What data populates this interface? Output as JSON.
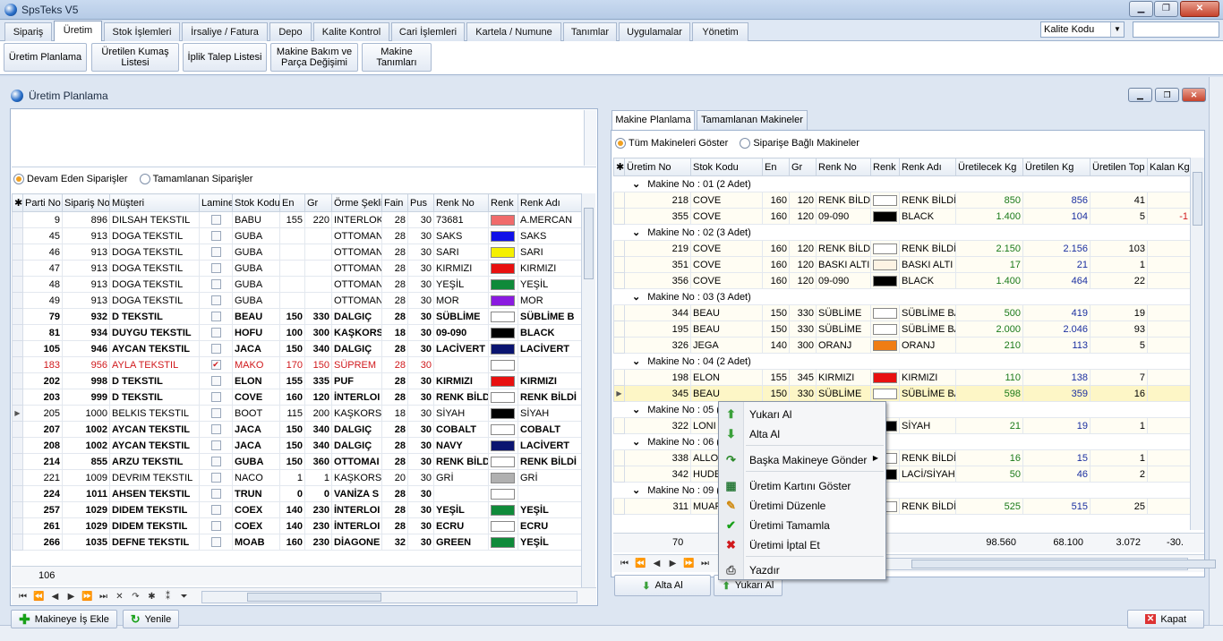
{
  "window": {
    "title": "SpsTeks V5",
    "min": "▁",
    "max": "❐",
    "close": "✕"
  },
  "menu_tabs": [
    "Sipariş",
    "Üretim",
    "Stok İşlemleri",
    "İrsaliye / Fatura",
    "Depo",
    "Kalite Kontrol",
    "Cari İşlemleri",
    "Kartela / Numune",
    "Tanımlar",
    "Uygulamalar",
    "Yönetim"
  ],
  "combo": {
    "value": "Kalite Kodu",
    "arrow": "▼"
  },
  "ribbon": [
    "Üretim Planlama",
    "Üretilen Kumaş Listesi",
    "İplik Talep Listesi",
    "Makine Bakım ve Parça Değişimi",
    "Makine Tanımları"
  ],
  "inner": {
    "title": "Üretim Planlama"
  },
  "left": {
    "radio1": "Devam Eden Siparişler",
    "radio2": "Tamamlanan Siparişler",
    "columns": [
      "Parti No",
      "Sipariş No",
      "Müşteri",
      "Lamine",
      "Stok Kodu",
      "En",
      "Gr",
      "Örme Şekli",
      "Fain",
      "Pus",
      "Renk No",
      "Renk",
      "Renk Adı"
    ],
    "rows": [
      {
        "parti": "9",
        "sip": "896",
        "mus": "DILSAH TEKSTIL",
        "lam": false,
        "stok": "BABU",
        "en": "155",
        "gr": "220",
        "orme": "INTERLOK",
        "fain": "28",
        "pus": "30",
        "rno": "73681",
        "color": "#f06b6b",
        "radi": "A.MERCAN",
        "style": ""
      },
      {
        "parti": "45",
        "sip": "913",
        "mus": "DOGA TEKSTIL",
        "lam": false,
        "stok": "GUBA",
        "en": "",
        "gr": "",
        "orme": "OTTOMAN",
        "fain": "28",
        "pus": "30",
        "rno": "SAKS",
        "color": "#1010e8",
        "radi": "SAKS",
        "style": ""
      },
      {
        "parti": "46",
        "sip": "913",
        "mus": "DOGA TEKSTIL",
        "lam": false,
        "stok": "GUBA",
        "en": "",
        "gr": "",
        "orme": "OTTOMAN",
        "fain": "28",
        "pus": "30",
        "rno": "SARI",
        "color": "#f5f000",
        "radi": "SARI",
        "style": ""
      },
      {
        "parti": "47",
        "sip": "913",
        "mus": "DOGA TEKSTIL",
        "lam": false,
        "stok": "GUBA",
        "en": "",
        "gr": "",
        "orme": "OTTOMAN",
        "fain": "28",
        "pus": "30",
        "rno": "KIRMIZI",
        "color": "#e81010",
        "radi": "KIRMIZI",
        "style": ""
      },
      {
        "parti": "48",
        "sip": "913",
        "mus": "DOGA TEKSTIL",
        "lam": false,
        "stok": "GUBA",
        "en": "",
        "gr": "",
        "orme": "OTTOMAN",
        "fain": "28",
        "pus": "30",
        "rno": "YEŞİL",
        "color": "#0f8a3a",
        "radi": "YEŞİL",
        "style": ""
      },
      {
        "parti": "49",
        "sip": "913",
        "mus": "DOGA TEKSTIL",
        "lam": false,
        "stok": "GUBA",
        "en": "",
        "gr": "",
        "orme": "OTTOMAN",
        "fain": "28",
        "pus": "30",
        "rno": "MOR",
        "color": "#8a1ae0",
        "radi": "MOR",
        "style": ""
      },
      {
        "parti": "79",
        "sip": "932",
        "mus": "D TEKSTIL",
        "lam": false,
        "stok": "BEAU",
        "en": "150",
        "gr": "330",
        "orme": "DALGIÇ",
        "fain": "28",
        "pus": "30",
        "rno": "SÜBLİME",
        "color": "#ffffff",
        "radi": "SÜBLİME B",
        "style": "bold"
      },
      {
        "parti": "81",
        "sip": "934",
        "mus": "DUYGU TEKSTIL",
        "lam": false,
        "stok": "HOFU",
        "en": "100",
        "gr": "300",
        "orme": "KAŞKORS",
        "fain": "18",
        "pus": "30",
        "rno": "09-090",
        "color": "#000000",
        "radi": "BLACK",
        "style": "bold"
      },
      {
        "parti": "105",
        "sip": "946",
        "mus": "AYCAN TEKSTIL",
        "lam": false,
        "stok": "JACA",
        "en": "150",
        "gr": "340",
        "orme": "DALGIÇ",
        "fain": "28",
        "pus": "30",
        "rno": "LACİVERT",
        "color": "#0a1470",
        "radi": "LACİVERT",
        "style": "bold"
      },
      {
        "parti": "183",
        "sip": "956",
        "mus": "AYLA TEKSTIL",
        "lam": true,
        "stok": "MAKO",
        "en": "170",
        "gr": "150",
        "orme": "SÜPREM",
        "fain": "28",
        "pus": "30",
        "rno": "",
        "color": "#ffffff",
        "radi": "",
        "style": "red"
      },
      {
        "parti": "202",
        "sip": "998",
        "mus": "D TEKSTIL",
        "lam": false,
        "stok": "ELON",
        "en": "155",
        "gr": "335",
        "orme": "PUF",
        "fain": "28",
        "pus": "30",
        "rno": "KIRMIZI",
        "color": "#e81010",
        "radi": "KIRMIZI",
        "style": "bold"
      },
      {
        "parti": "203",
        "sip": "999",
        "mus": "D TEKSTIL",
        "lam": false,
        "stok": "COVE",
        "en": "160",
        "gr": "120",
        "orme": "İNTERLOI",
        "fain": "28",
        "pus": "30",
        "rno": "RENK BİLD",
        "color": "#ffffff",
        "radi": "RENK BİLDİ",
        "style": "bold"
      },
      {
        "parti": "205",
        "sip": "1000",
        "mus": "BELKIS TEKSTIL",
        "lam": false,
        "stok": "BOOT",
        "en": "115",
        "gr": "200",
        "orme": "KAŞKORSE",
        "fain": "18",
        "pus": "30",
        "rno": "SİYAH",
        "color": "#000000",
        "radi": "SİYAH",
        "style": ""
      },
      {
        "parti": "207",
        "sip": "1002",
        "mus": "AYCAN TEKSTIL",
        "lam": false,
        "stok": "JACA",
        "en": "150",
        "gr": "340",
        "orme": "DALGIÇ",
        "fain": "28",
        "pus": "30",
        "rno": "COBALT",
        "color": "#ffffff",
        "radi": "COBALT",
        "style": "bold"
      },
      {
        "parti": "208",
        "sip": "1002",
        "mus": "AYCAN TEKSTIL",
        "lam": false,
        "stok": "JACA",
        "en": "150",
        "gr": "340",
        "orme": "DALGIÇ",
        "fain": "28",
        "pus": "30",
        "rno": "NAVY",
        "color": "#0a1470",
        "radi": "LACİVERT",
        "style": "bold"
      },
      {
        "parti": "214",
        "sip": "855",
        "mus": "ARZU TEKSTIL",
        "lam": false,
        "stok": "GUBA",
        "en": "150",
        "gr": "360",
        "orme": "OTTOMAI",
        "fain": "28",
        "pus": "30",
        "rno": "RENK BİLD",
        "color": "#ffffff",
        "radi": "RENK BİLDİ",
        "style": "bold"
      },
      {
        "parti": "221",
        "sip": "1009",
        "mus": "DEVRIM TEKSTIL",
        "lam": false,
        "stok": "NACO",
        "en": "1",
        "gr": "1",
        "orme": "KAŞKORSE",
        "fain": "20",
        "pus": "30",
        "rno": "GRİ",
        "color": "#b0b0b0",
        "radi": "GRİ",
        "style": ""
      },
      {
        "parti": "224",
        "sip": "1011",
        "mus": "AHSEN TEKSTIL",
        "lam": false,
        "stok": "TRUN",
        "en": "0",
        "gr": "0",
        "orme": "VANİZA S",
        "fain": "28",
        "pus": "30",
        "rno": "",
        "color": "#ffffff",
        "radi": "",
        "style": "bold"
      },
      {
        "parti": "257",
        "sip": "1029",
        "mus": "DIDEM TEKSTIL",
        "lam": false,
        "stok": "COEX",
        "en": "140",
        "gr": "230",
        "orme": "İNTERLOI",
        "fain": "28",
        "pus": "30",
        "rno": "YEŞİL",
        "color": "#0f8a3a",
        "radi": "YEŞİL",
        "style": "bold"
      },
      {
        "parti": "261",
        "sip": "1029",
        "mus": "DIDEM TEKSTIL",
        "lam": false,
        "stok": "COEX",
        "en": "140",
        "gr": "230",
        "orme": "İNTERLOI",
        "fain": "28",
        "pus": "30",
        "rno": "ECRU",
        "color": "#ffffff",
        "radi": "ECRU",
        "style": "bold"
      },
      {
        "parti": "266",
        "sip": "1035",
        "mus": "DEFNE TEKSTIL",
        "lam": false,
        "stok": "MOAB",
        "en": "160",
        "gr": "230",
        "orme": "DİAGONE",
        "fain": "32",
        "pus": "30",
        "rno": "GREEN",
        "color": "#0f8a3a",
        "radi": "YEŞİL",
        "style": "bold"
      }
    ],
    "count": "106"
  },
  "right": {
    "tab1": "Makine Planlama",
    "tab2": "Tamamlanan Makineler",
    "radio1": "Tüm Makineleri Göster",
    "radio2": "Siparişe Bağlı Makineler",
    "columns": [
      "Üretim No",
      "Stok Kodu",
      "En",
      "Gr",
      "Renk No",
      "Renk",
      "Renk Adı",
      "Üretilecek Kg",
      "Üretilen Kg",
      "Üretilen Top",
      "Kalan Kg"
    ],
    "groups": [
      {
        "title": "Makine No : 01 (2 Adet)",
        "rows": [
          {
            "no": "218",
            "stok": "COVE",
            "en": "160",
            "gr": "120",
            "rno": "RENK BİLD.",
            "color": "#ffffff",
            "radi": "RENK BİLDİF",
            "kg": "850",
            "ukg": "856",
            "top": "41",
            "kalan": ""
          },
          {
            "no": "355",
            "stok": "COVE",
            "en": "160",
            "gr": "120",
            "rno": "09-090",
            "color": "#000000",
            "radi": "BLACK",
            "kg": "1.400",
            "ukg": "104",
            "top": "5",
            "kalan": "-1"
          }
        ]
      },
      {
        "title": "Makine No : 02 (3 Adet)",
        "rows": [
          {
            "no": "219",
            "stok": "COVE",
            "en": "160",
            "gr": "120",
            "rno": "RENK BİLD.",
            "color": "#ffffff",
            "radi": "RENK BİLDİF",
            "kg": "2.150",
            "ukg": "2.156",
            "top": "103",
            "kalan": ""
          },
          {
            "no": "351",
            "stok": "COVE",
            "en": "160",
            "gr": "120",
            "rno": "BASKI ALTI",
            "color": "#fdf3e4",
            "radi": "BASKI ALTI",
            "kg": "17",
            "ukg": "21",
            "top": "1",
            "kalan": ""
          },
          {
            "no": "356",
            "stok": "COVE",
            "en": "160",
            "gr": "120",
            "rno": "09-090",
            "color": "#000000",
            "radi": "BLACK",
            "kg": "1.400",
            "ukg": "464",
            "top": "22",
            "kalan": ""
          }
        ]
      },
      {
        "title": "Makine No : 03 (3 Adet)",
        "rows": [
          {
            "no": "344",
            "stok": "BEAU",
            "en": "150",
            "gr": "330",
            "rno": "SÜBLİME",
            "color": "#ffffff",
            "radi": "SÜBLİME BA",
            "kg": "500",
            "ukg": "419",
            "top": "19",
            "kalan": ""
          },
          {
            "no": "195",
            "stok": "BEAU",
            "en": "150",
            "gr": "330",
            "rno": "SÜBLİME",
            "color": "#ffffff",
            "radi": "SÜBLİME BA",
            "kg": "2.000",
            "ukg": "2.046",
            "top": "93",
            "kalan": ""
          },
          {
            "no": "326",
            "stok": "JEGA",
            "en": "140",
            "gr": "300",
            "rno": "ORANJ",
            "color": "#f07d14",
            "radi": "ORANJ",
            "kg": "210",
            "ukg": "113",
            "top": "5",
            "kalan": ""
          }
        ]
      },
      {
        "title": "Makine No : 04 (2 Adet)",
        "rows": [
          {
            "no": "198",
            "stok": "ELON",
            "en": "155",
            "gr": "345",
            "rno": "KIRMIZI",
            "color": "#e81010",
            "radi": "KIRMIZI",
            "kg": "110",
            "ukg": "138",
            "top": "7",
            "kalan": ""
          },
          {
            "no": "345",
            "stok": "BEAU",
            "en": "150",
            "gr": "330",
            "rno": "SÜBLİME",
            "color": "#ffffff",
            "radi": "SÜBLİME BA",
            "kg": "598",
            "ukg": "359",
            "top": "16",
            "kalan": "",
            "sel": true
          }
        ]
      },
      {
        "title": "Makine No : 05 (1",
        "rows": [
          {
            "no": "322",
            "stok": "LONI",
            "en": "",
            "gr": "",
            "rno": "",
            "color": "#000000",
            "radi": "SİYAH",
            "kg": "21",
            "ukg": "19",
            "top": "1",
            "kalan": ""
          }
        ]
      },
      {
        "title": "Makine No : 06 (2",
        "rows": [
          {
            "no": "338",
            "stok": "ALLOA",
            "en": "",
            "gr": "",
            "rno": "",
            "color": "#ffffff",
            "radi": "RENK BİLDİF",
            "kg": "16",
            "ukg": "15",
            "top": "1",
            "kalan": ""
          },
          {
            "no": "342",
            "stok": "HUDE",
            "en": "",
            "gr": "",
            "rno": "",
            "color": "#000000",
            "radi": "LACİ/SİYAH",
            "kg": "50",
            "ukg": "46",
            "top": "2",
            "kalan": ""
          }
        ]
      },
      {
        "title": "Makine No : 09 (2",
        "rows": [
          {
            "no": "311",
            "stok": "MUAR",
            "en": "",
            "gr": "",
            "rno": "",
            "color": "#ffffff",
            "radi": "RENK BİLDİF",
            "kg": "525",
            "ukg": "515",
            "top": "25",
            "kalan": ""
          }
        ]
      }
    ],
    "footer": {
      "count": "70",
      "kg": "98.560",
      "ukg": "68.100",
      "top": "3.072",
      "kalan": "-30."
    },
    "btn_alta": "Alta Al",
    "btn_yukari": "Yukarı Al"
  },
  "context_menu": {
    "items": [
      "Yukarı Al",
      "Alta Al",
      "Başka Makineye Gönder",
      "Üretim Kartını Göster",
      "Üretimi Düzenle",
      "Üretimi Tamamla",
      "Üretimi İptal Et",
      "Yazdır"
    ],
    "submenu_arrow": "▶"
  },
  "bottom": {
    "makineye": "Makineye İş Ekle",
    "yenile": "Yenile",
    "kapat": "Kapat"
  },
  "nav": [
    "⏮",
    "⏪",
    "◀",
    "▶",
    "⏩",
    "⏭",
    "✕",
    "↷",
    "✱",
    "⁑",
    "⏷"
  ]
}
